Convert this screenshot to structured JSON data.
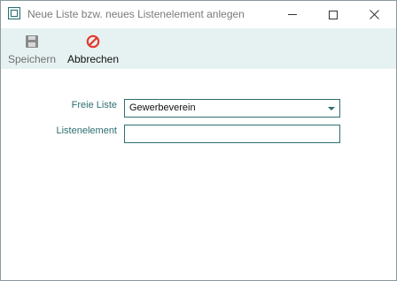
{
  "window": {
    "title": "Neue Liste bzw. neues Listenelement anlegen",
    "icon": "list-window-icon"
  },
  "toolbar": {
    "save_label": "Speichern",
    "save_icon": "floppy-disk-icon",
    "cancel_label": "Abbrechen",
    "cancel_icon": "prohibited-icon"
  },
  "form": {
    "freie_liste_label": "Freie Liste",
    "freie_liste_value": "Gewerbeverein",
    "listenelement_label": "Listenelement",
    "listenelement_value": ""
  },
  "colors": {
    "accent": "#2e6e6e",
    "toolbar_bg": "#e6f2f1",
    "cancel_icon": "#e23b2e"
  }
}
